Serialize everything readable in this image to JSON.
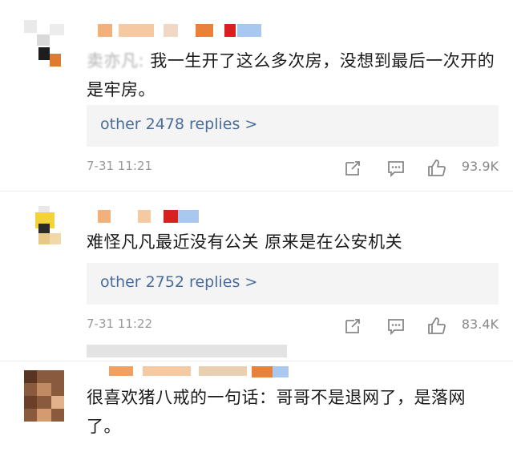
{
  "comments": [
    {
      "text_masked": "卖亦凡:",
      "text": "我一生开了这么多次房，没想到最后一次开的是牢房。",
      "replies_label": "other 2478 replies >",
      "time": "7-31 11:21",
      "likes": "93.9K"
    },
    {
      "text": "难怪凡凡最近没有公关 原来是在公安机关",
      "replies_label": "other 2752 replies >",
      "time": "7-31 11:22",
      "likes": "83.4K"
    },
    {
      "text": "很喜欢猪八戒的一句话：哥哥不是退网了，是落网了。"
    }
  ],
  "icons": {
    "share": "share-icon",
    "comment": "comment-icon",
    "like": "thumbs-up-icon"
  },
  "colors": {
    "link": "#4a6c9b",
    "meta": "#9a9a9a",
    "reply_bg": "#f4f4f4"
  }
}
